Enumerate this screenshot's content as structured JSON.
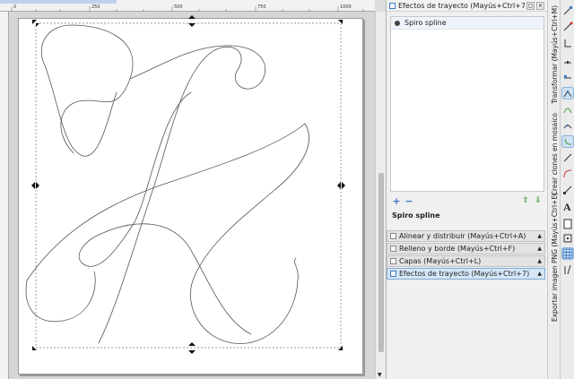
{
  "ruler": {
    "labels": [
      "0",
      "250",
      "500",
      "750",
      "1000"
    ]
  },
  "lpe_panel": {
    "title": "Efectos de trayecto (Mayús+Ctrl+7)",
    "effects": [
      {
        "label": "Spiro spline"
      }
    ],
    "add_label": "+",
    "remove_label": "−",
    "selected_effect_name": "Spiro spline"
  },
  "collapsed_panels": [
    {
      "label": "Alinear y distribuir (Mayús+Ctrl+A)"
    },
    {
      "label": "Relleno y borde (Mayús+Ctrl+F)"
    },
    {
      "label": "Capas (Mayús+Ctrl+L)"
    },
    {
      "label": "Efectos de trayecto (Mayús+Ctrl+7)"
    }
  ],
  "vertical_tabs": [
    {
      "label": "Transformar (Mayús+Ctrl+M)"
    },
    {
      "label": "Crear clones en mosaico"
    },
    {
      "label": "Exportar imagen PNG (Mayús+Ctrl+E)"
    }
  ],
  "colors": {
    "accent": "#3b78c4",
    "selection_bg": "#d5e6f7",
    "stroke": "#555555",
    "add_green": "#3a9a3a"
  }
}
